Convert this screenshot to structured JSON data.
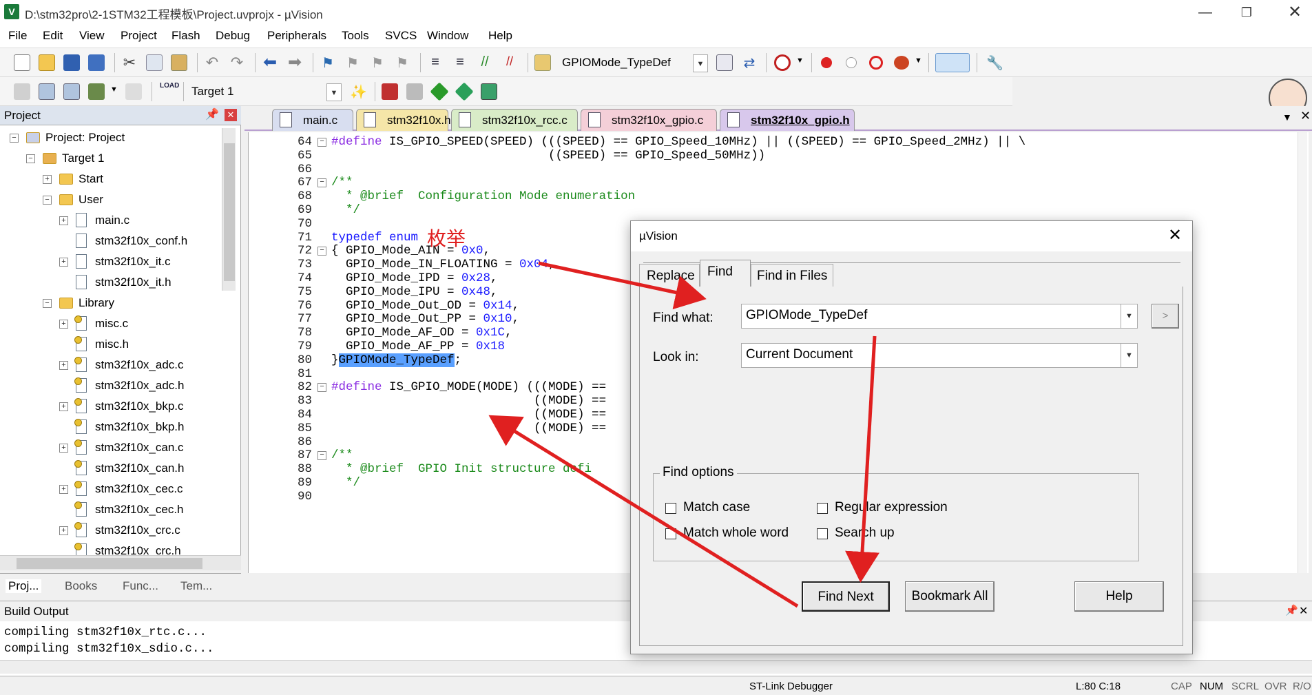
{
  "window": {
    "title": "D:\\stm32pro\\2-1STM32工程模板\\Project.uvprojx - µVision",
    "app_icon": "V"
  },
  "menu": [
    "File",
    "Edit",
    "View",
    "Project",
    "Flash",
    "Debug",
    "Peripherals",
    "Tools",
    "SVCS",
    "Window",
    "Help"
  ],
  "toolbar": {
    "find_combo_value": "GPIOMode_TypeDef",
    "target_combo_value": "Target 1"
  },
  "project_panel": {
    "title": "Project",
    "items": [
      {
        "label": "Project: Project",
        "level": 0,
        "expander": "−",
        "icon": "project-icon"
      },
      {
        "label": "Target 1",
        "level": 1,
        "expander": "−",
        "icon": "target-icon"
      },
      {
        "label": "Start",
        "level": 2,
        "expander": "+",
        "icon": "folder-icon"
      },
      {
        "label": "User",
        "level": 2,
        "expander": "−",
        "icon": "folder-icon"
      },
      {
        "label": "main.c",
        "level": 3,
        "expander": "+",
        "icon": "file-icon"
      },
      {
        "label": "stm32f10x_conf.h",
        "level": 3,
        "expander": "",
        "icon": "file-icon"
      },
      {
        "label": "stm32f10x_it.c",
        "level": 3,
        "expander": "+",
        "icon": "file-icon"
      },
      {
        "label": "stm32f10x_it.h",
        "level": 3,
        "expander": "",
        "icon": "file-icon"
      },
      {
        "label": "Library",
        "level": 2,
        "expander": "−",
        "icon": "folder-icon"
      },
      {
        "label": "misc.c",
        "level": 3,
        "expander": "+",
        "icon": "header-key-icon"
      },
      {
        "label": "misc.h",
        "level": 3,
        "expander": "",
        "icon": "header-key-icon"
      },
      {
        "label": "stm32f10x_adc.c",
        "level": 3,
        "expander": "+",
        "icon": "header-key-icon"
      },
      {
        "label": "stm32f10x_adc.h",
        "level": 3,
        "expander": "",
        "icon": "header-key-icon"
      },
      {
        "label": "stm32f10x_bkp.c",
        "level": 3,
        "expander": "+",
        "icon": "header-key-icon"
      },
      {
        "label": "stm32f10x_bkp.h",
        "level": 3,
        "expander": "",
        "icon": "header-key-icon"
      },
      {
        "label": "stm32f10x_can.c",
        "level": 3,
        "expander": "+",
        "icon": "header-key-icon"
      },
      {
        "label": "stm32f10x_can.h",
        "level": 3,
        "expander": "",
        "icon": "header-key-icon"
      },
      {
        "label": "stm32f10x_cec.c",
        "level": 3,
        "expander": "+",
        "icon": "header-key-icon"
      },
      {
        "label": "stm32f10x_cec.h",
        "level": 3,
        "expander": "",
        "icon": "header-key-icon"
      },
      {
        "label": "stm32f10x_crc.c",
        "level": 3,
        "expander": "+",
        "icon": "header-key-icon"
      },
      {
        "label": "stm32f10x_crc.h",
        "level": 3,
        "expander": "",
        "icon": "header-key-icon"
      }
    ],
    "bottom_tabs": [
      "Proj...",
      "Books",
      "Func...",
      "Tem..."
    ]
  },
  "editor_tabs": [
    {
      "label": "main.c",
      "color": "#d8def0"
    },
    {
      "label": "stm32f10x.h",
      "color": "#f5e6a8"
    },
    {
      "label": "stm32f10x_rcc.c",
      "color": "#d9ecc8"
    },
    {
      "label": "stm32f10x_gpio.c",
      "color": "#f4cfd8"
    },
    {
      "label": "stm32f10x_gpio.h",
      "color": "#d8c8ec",
      "active": true
    }
  ],
  "code_lines": [
    {
      "n": "64",
      "fold": "−",
      "parts": [
        [
          "pp",
          "#define "
        ],
        [
          "",
          "IS_GPIO_SPEED(SPEED) (((SPEED) == GPIO_Speed_10MHz) || ((SPEED) == GPIO_Speed_2MHz) || \\"
        ]
      ]
    },
    {
      "n": "65",
      "fold": "",
      "parts": [
        [
          "",
          "                              ((SPEED) == GPIO_Speed_50MHz))"
        ]
      ]
    },
    {
      "n": "66",
      "fold": "",
      "parts": []
    },
    {
      "n": "67",
      "fold": "−",
      "parts": [
        [
          "cm",
          "/**"
        ]
      ]
    },
    {
      "n": "68",
      "fold": "",
      "parts": [
        [
          "cm",
          "  * @brief  Configuration Mode enumeration"
        ]
      ]
    },
    {
      "n": "69",
      "fold": "",
      "parts": [
        [
          "cm",
          "  */"
        ]
      ]
    },
    {
      "n": "70",
      "fold": "",
      "parts": []
    },
    {
      "n": "71",
      "fold": "",
      "parts": [
        [
          "kw",
          "typedef enum"
        ]
      ]
    },
    {
      "n": "72",
      "fold": "−",
      "parts": [
        [
          "",
          "{ GPIO_Mode_AIN = "
        ],
        [
          "nm",
          "0x0"
        ],
        [
          "",
          ","
        ]
      ]
    },
    {
      "n": "73",
      "fold": "",
      "parts": [
        [
          "",
          "  GPIO_Mode_IN_FLOATING = "
        ],
        [
          "nm",
          "0x04"
        ],
        [
          "",
          ","
        ]
      ]
    },
    {
      "n": "74",
      "fold": "",
      "parts": [
        [
          "",
          "  GPIO_Mode_IPD = "
        ],
        [
          "nm",
          "0x28"
        ],
        [
          "",
          ","
        ]
      ]
    },
    {
      "n": "75",
      "fold": "",
      "parts": [
        [
          "",
          "  GPIO_Mode_IPU = "
        ],
        [
          "nm",
          "0x48"
        ],
        [
          "",
          ","
        ]
      ]
    },
    {
      "n": "76",
      "fold": "",
      "parts": [
        [
          "",
          "  GPIO_Mode_Out_OD = "
        ],
        [
          "nm",
          "0x14"
        ],
        [
          "",
          ","
        ]
      ]
    },
    {
      "n": "77",
      "fold": "",
      "parts": [
        [
          "",
          "  GPIO_Mode_Out_PP = "
        ],
        [
          "nm",
          "0x10"
        ],
        [
          "",
          ","
        ]
      ]
    },
    {
      "n": "78",
      "fold": "",
      "parts": [
        [
          "",
          "  GPIO_Mode_AF_OD = "
        ],
        [
          "nm",
          "0x1C"
        ],
        [
          "",
          ","
        ]
      ]
    },
    {
      "n": "79",
      "fold": "",
      "parts": [
        [
          "",
          "  GPIO_Mode_AF_PP = "
        ],
        [
          "nm",
          "0x18"
        ]
      ]
    },
    {
      "n": "80",
      "fold": "",
      "parts": [
        [
          "",
          "}"
        ],
        [
          "hl",
          "GPIOMode_TypeDef"
        ],
        [
          "",
          ";"
        ]
      ]
    },
    {
      "n": "81",
      "fold": "",
      "parts": []
    },
    {
      "n": "82",
      "fold": "−",
      "parts": [
        [
          "pp",
          "#define "
        ],
        [
          "",
          "IS_GPIO_MODE(MODE) (((MODE) =="
        ]
      ]
    },
    {
      "n": "83",
      "fold": "",
      "parts": [
        [
          "",
          "                            ((MODE) =="
        ]
      ]
    },
    {
      "n": "84",
      "fold": "",
      "parts": [
        [
          "",
          "                            ((MODE) =="
        ]
      ]
    },
    {
      "n": "85",
      "fold": "",
      "parts": [
        [
          "",
          "                            ((MODE) =="
        ]
      ]
    },
    {
      "n": "86",
      "fold": "",
      "parts": []
    },
    {
      "n": "87",
      "fold": "−",
      "parts": [
        [
          "cm",
          "/**"
        ]
      ]
    },
    {
      "n": "88",
      "fold": "",
      "parts": [
        [
          "cm",
          "  * @brief  GPIO Init structure defi"
        ]
      ]
    },
    {
      "n": "89",
      "fold": "",
      "parts": [
        [
          "cm",
          "  */"
        ]
      ]
    },
    {
      "n": "90",
      "fold": "",
      "parts": []
    }
  ],
  "annotation": {
    "text": "枚举"
  },
  "build_output": {
    "title": "Build Output",
    "lines": [
      "compiling stm32f10x_rtc.c...",
      "compiling stm32f10x_sdio.c..."
    ]
  },
  "status": {
    "debugger": "ST-Link Debugger",
    "position": "L:80 C:18",
    "flags": [
      "CAP",
      "NUM",
      "SCRL",
      "OVR",
      "R/O"
    ]
  },
  "dialog": {
    "title": "µVision",
    "tabs": [
      "Replace",
      "Find",
      "Find in Files"
    ],
    "find_what_label": "Find what:",
    "find_what_value": "GPIOMode_TypeDef",
    "look_in_label": "Look in:",
    "look_in_value": "Current Document",
    "options_title": "Find options",
    "options": [
      {
        "label": "Match case",
        "checked": false
      },
      {
        "label": "Regular expression",
        "checked": false
      },
      {
        "label": "Match whole word",
        "checked": false
      },
      {
        "label": "Search up",
        "checked": false
      }
    ],
    "buttons": {
      "find_next": "Find Next",
      "bookmark_all": "Bookmark All",
      "help": "Help",
      "more": ">"
    }
  },
  "colors": {
    "arrow": "#e02020",
    "selection": "#5aa0ff",
    "active_tab_underline": "#b9a0d0"
  }
}
